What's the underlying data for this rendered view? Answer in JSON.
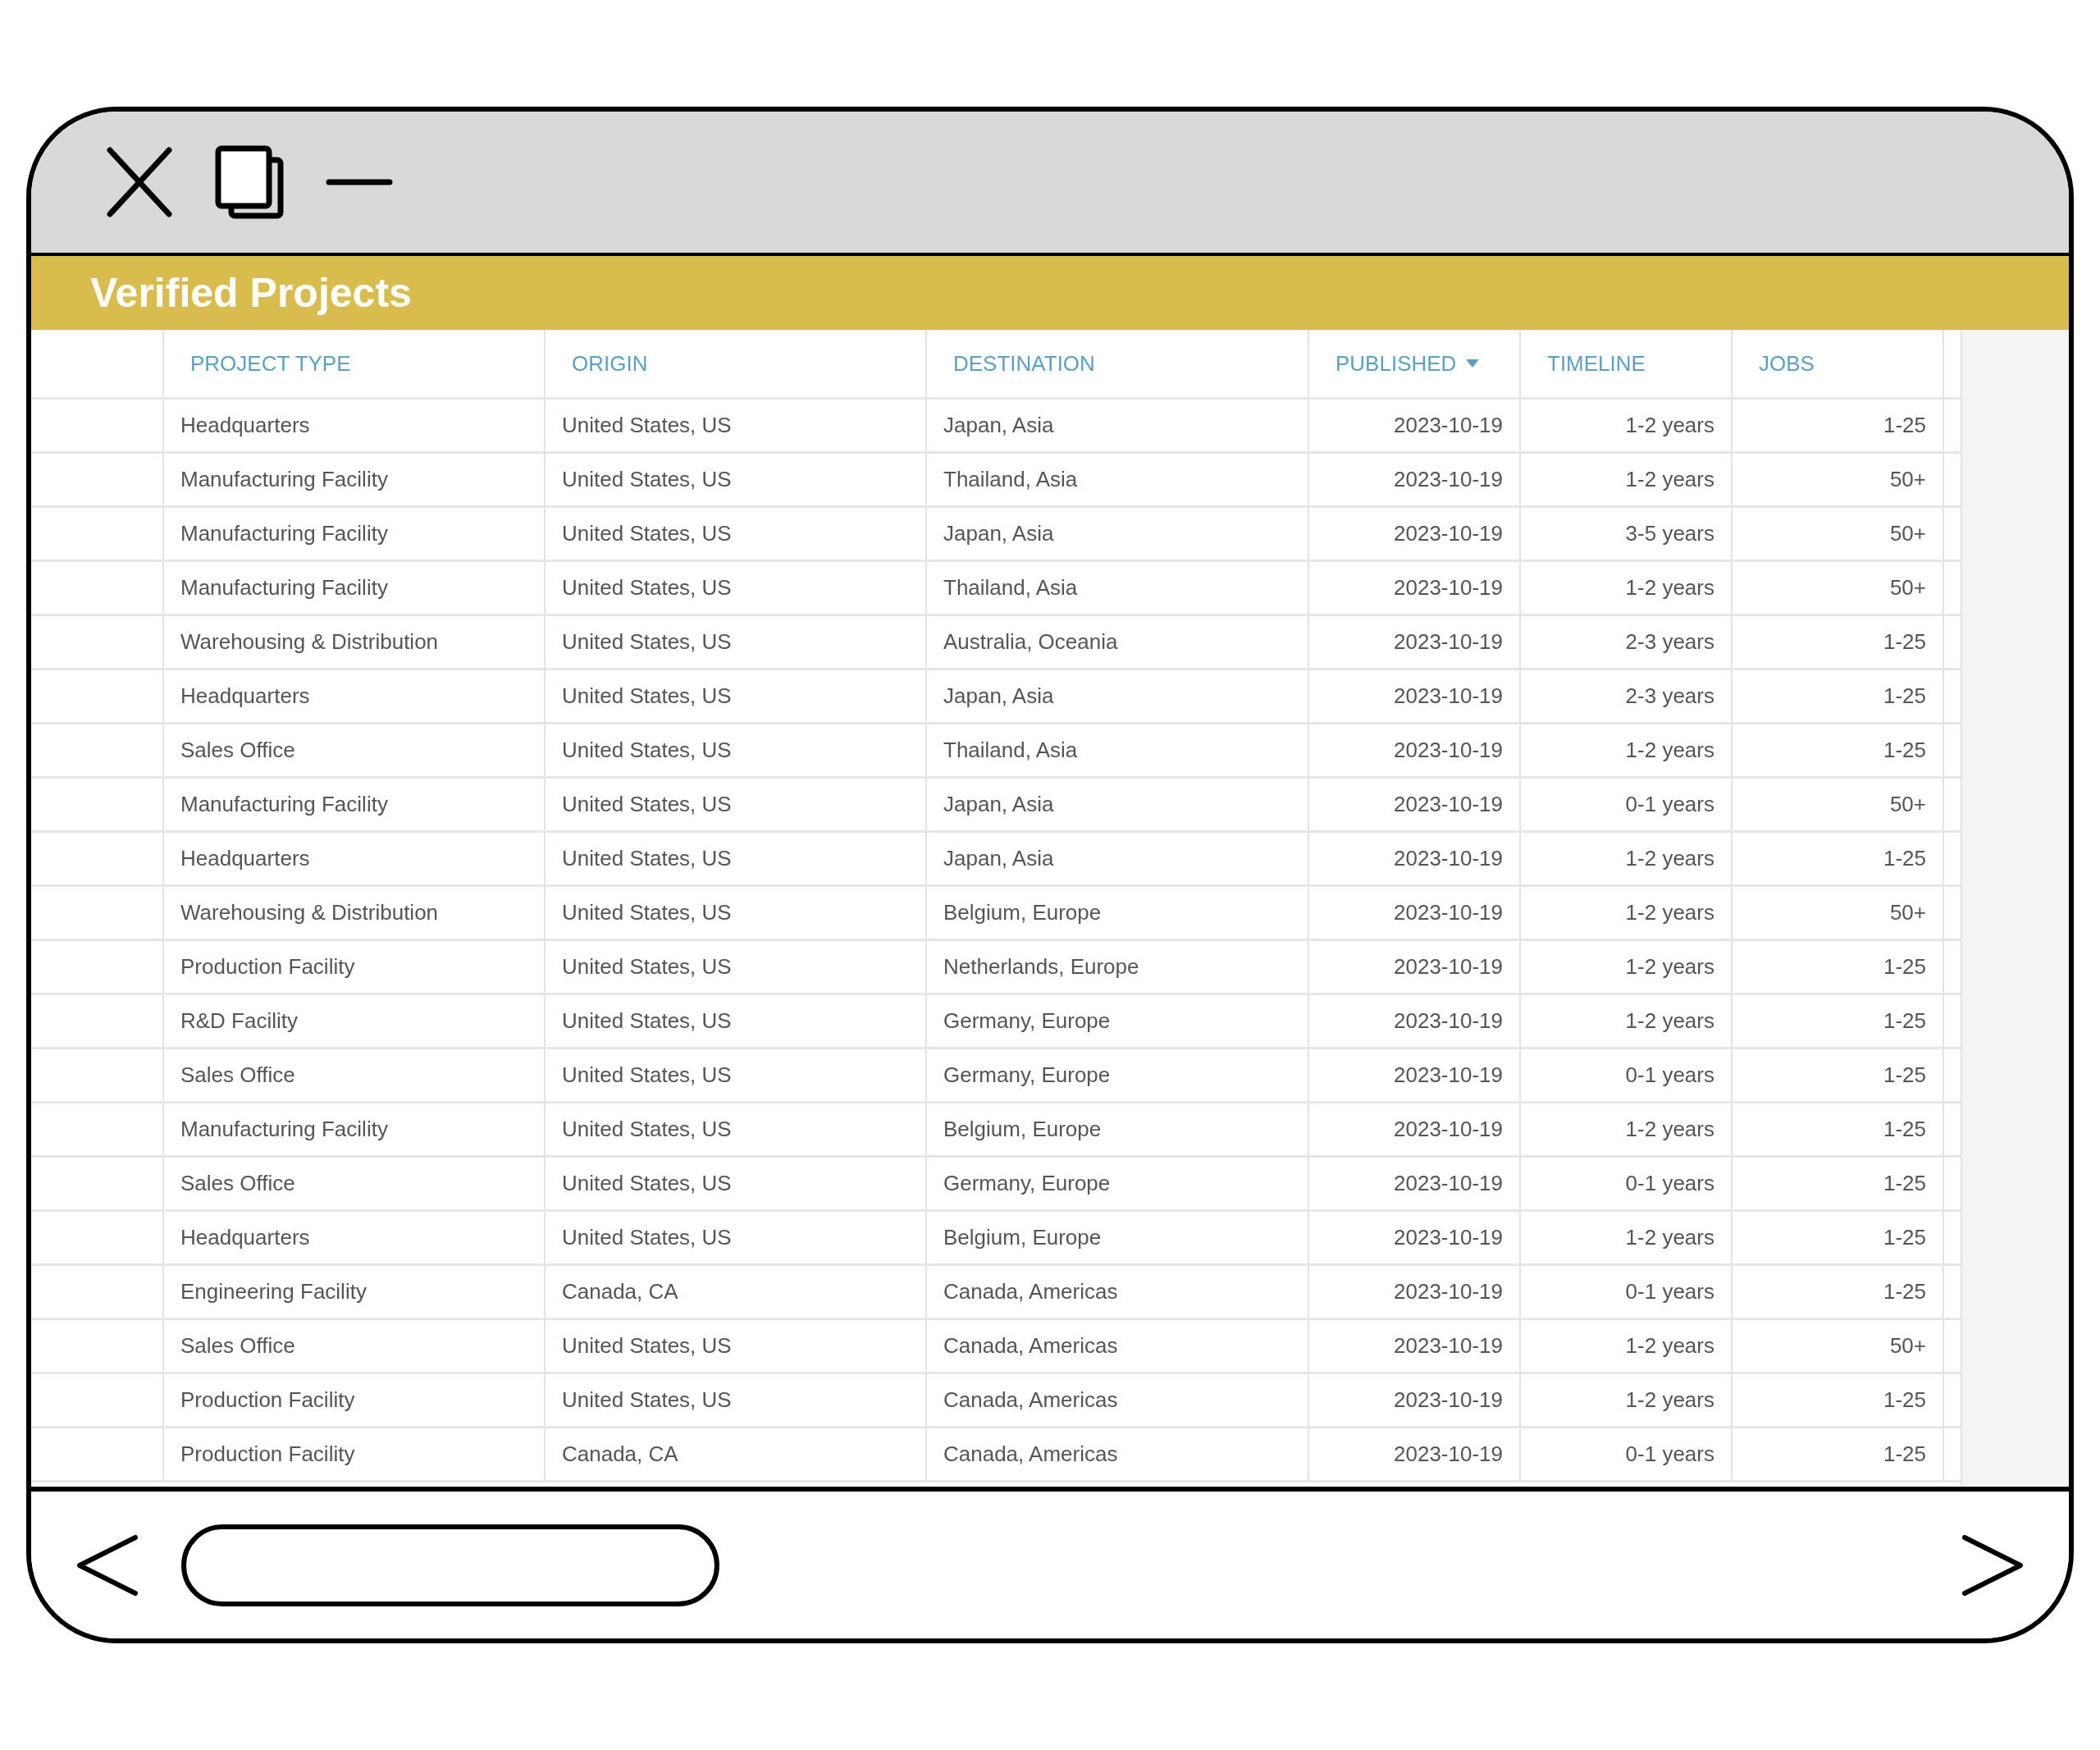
{
  "window": {
    "title": "Verified Projects"
  },
  "table": {
    "columns": [
      {
        "label": "PROJECT TYPE",
        "sorted": false
      },
      {
        "label": "ORIGIN",
        "sorted": false
      },
      {
        "label": "DESTINATION",
        "sorted": false
      },
      {
        "label": "PUBLISHED",
        "sorted": true
      },
      {
        "label": "TIMELINE",
        "sorted": false
      },
      {
        "label": "JOBS",
        "sorted": false
      }
    ],
    "rows": [
      {
        "cells": [
          "Headquarters",
          "United States, US",
          "Japan, Asia",
          "2023-10-19",
          "1-2 years",
          "1-25"
        ]
      },
      {
        "cells": [
          "Manufacturing Facility",
          "United States, US",
          "Thailand, Asia",
          "2023-10-19",
          "1-2 years",
          "50+"
        ]
      },
      {
        "cells": [
          "Manufacturing Facility",
          "United States, US",
          "Japan, Asia",
          "2023-10-19",
          "3-5 years",
          "50+"
        ]
      },
      {
        "cells": [
          "Manufacturing Facility",
          "United States, US",
          "Thailand, Asia",
          "2023-10-19",
          "1-2 years",
          "50+"
        ]
      },
      {
        "cells": [
          "Warehousing & Distribution",
          "United States, US",
          "Australia, Oceania",
          "2023-10-19",
          "2-3 years",
          "1-25"
        ]
      },
      {
        "cells": [
          "Headquarters",
          "United States, US",
          "Japan, Asia",
          "2023-10-19",
          "2-3 years",
          "1-25"
        ]
      },
      {
        "cells": [
          "Sales Office",
          "United States, US",
          "Thailand, Asia",
          "2023-10-19",
          "1-2 years",
          "1-25"
        ]
      },
      {
        "cells": [
          "Manufacturing Facility",
          "United States, US",
          "Japan, Asia",
          "2023-10-19",
          "0-1 years",
          "50+"
        ]
      },
      {
        "cells": [
          "Headquarters",
          "United States, US",
          "Japan, Asia",
          "2023-10-19",
          "1-2 years",
          "1-25"
        ]
      },
      {
        "cells": [
          "Warehousing & Distribution",
          "United States, US",
          "Belgium, Europe",
          "2023-10-19",
          "1-2 years",
          "50+"
        ]
      },
      {
        "cells": [
          "Production Facility",
          "United States, US",
          "Netherlands, Europe",
          "2023-10-19",
          "1-2 years",
          "1-25"
        ]
      },
      {
        "cells": [
          "R&D Facility",
          "United States, US",
          "Germany, Europe",
          "2023-10-19",
          "1-2 years",
          "1-25"
        ]
      },
      {
        "cells": [
          "Sales Office",
          "United States, US",
          "Germany, Europe",
          "2023-10-19",
          "0-1 years",
          "1-25"
        ]
      },
      {
        "cells": [
          "Manufacturing Facility",
          "United States, US",
          "Belgium, Europe",
          "2023-10-19",
          "1-2 years",
          "1-25"
        ]
      },
      {
        "cells": [
          "Sales Office",
          "United States, US",
          "Germany, Europe",
          "2023-10-19",
          "0-1 years",
          "1-25"
        ]
      },
      {
        "cells": [
          "Headquarters",
          "United States, US",
          "Belgium, Europe",
          "2023-10-19",
          "1-2 years",
          "1-25"
        ]
      },
      {
        "cells": [
          "Engineering Facility",
          "Canada, CA",
          "Canada, Americas",
          "2023-10-19",
          "0-1 years",
          "1-25"
        ]
      },
      {
        "cells": [
          "Sales Office",
          "United States, US",
          "Canada, Americas",
          "2023-10-19",
          "1-2 years",
          "50+"
        ]
      },
      {
        "cells": [
          "Production Facility",
          "United States, US",
          "Canada, Americas",
          "2023-10-19",
          "1-2 years",
          "1-25"
        ]
      },
      {
        "cells": [
          "Production Facility",
          "Canada, CA",
          "Canada, Americas",
          "2023-10-19",
          "0-1 years",
          "1-25"
        ]
      }
    ]
  }
}
